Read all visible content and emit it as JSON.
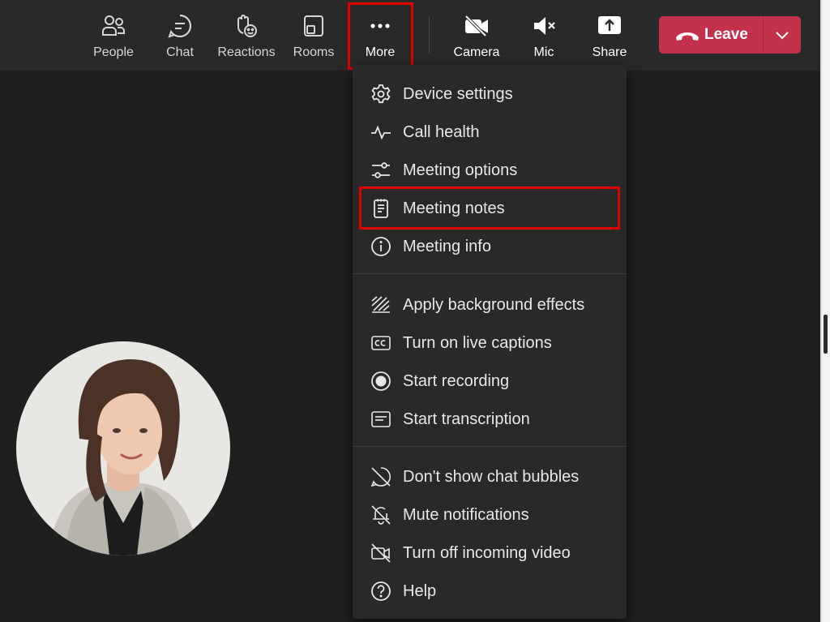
{
  "toolbar": {
    "people": "People",
    "chat": "Chat",
    "reactions": "Reactions",
    "rooms": "Rooms",
    "more": "More",
    "camera": "Camera",
    "mic": "Mic",
    "share": "Share",
    "leave": "Leave"
  },
  "menu": {
    "device_settings": "Device settings",
    "call_health": "Call health",
    "meeting_options": "Meeting options",
    "meeting_notes": "Meeting notes",
    "meeting_info": "Meeting info",
    "apply_background": "Apply background effects",
    "live_captions": "Turn on live captions",
    "start_recording": "Start recording",
    "start_transcription": "Start transcription",
    "chat_bubbles": "Don't show chat bubbles",
    "mute_notifications": "Mute notifications",
    "incoming_video": "Turn off incoming video",
    "help": "Help"
  },
  "colors": {
    "leave_button": "#c4314b",
    "highlight_box": "#e00000",
    "toolbar_bg": "#292929",
    "stage_bg": "#1f1f1f"
  }
}
